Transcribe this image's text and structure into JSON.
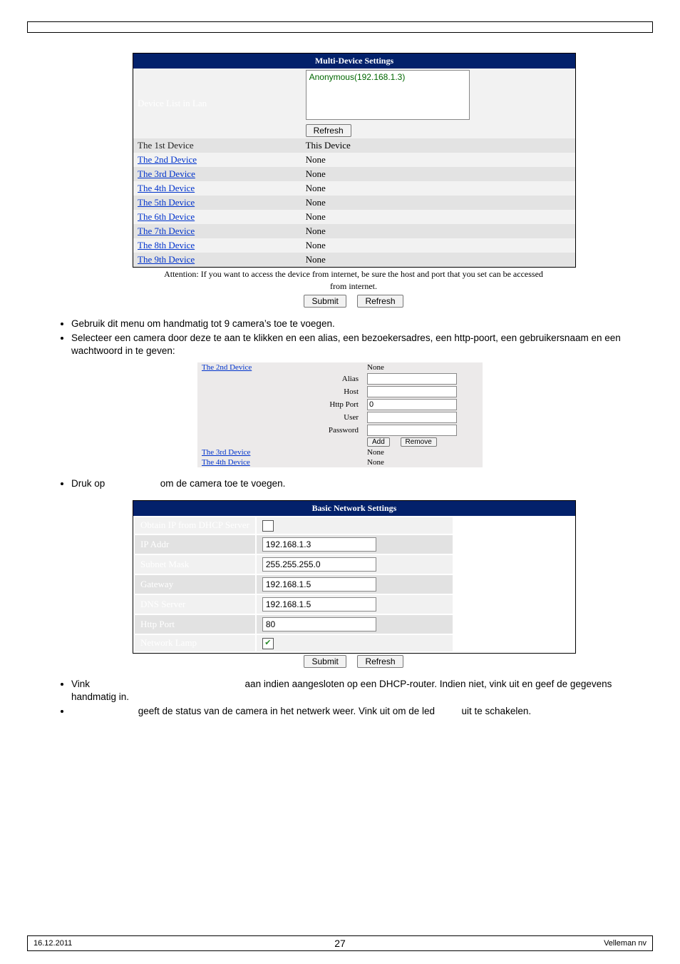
{
  "multi_device": {
    "header": "Multi-Device Settings",
    "row_labels": {
      "device_list": "Device List in Lan"
    },
    "listbox_entry": "Anonymous(192.168.1.3)",
    "refresh_btn": "Refresh",
    "devices": [
      {
        "label": "The 1st Device",
        "value": "This Device",
        "link": false
      },
      {
        "label": "The 2nd Device",
        "value": "None",
        "link": true
      },
      {
        "label": "The 3rd Device",
        "value": "None",
        "link": true
      },
      {
        "label": "The 4th Device",
        "value": "None",
        "link": true
      },
      {
        "label": "The 5th Device",
        "value": "None",
        "link": true
      },
      {
        "label": "The 6th Device",
        "value": "None",
        "link": true
      },
      {
        "label": "The 7th Device",
        "value": "None",
        "link": true
      },
      {
        "label": "The 8th Device",
        "value": "None",
        "link": true
      },
      {
        "label": "The 9th Device",
        "value": "None",
        "link": true
      }
    ],
    "attention_line1": "Attention: If you want to access the device from internet, be sure the host and port that you set can be accessed",
    "attention_line2": "from internet.",
    "submit_btn": "Submit",
    "refresh2_btn": "Refresh"
  },
  "bullets_1": {
    "b1": "Gebruik dit menu om handmatig tot 9 camera’s toe te voegen.",
    "b2": "Selecteer een camera door deze te aan te klikken en een alias, een bezoekersadres, een http-poort, een gebruikersnaam en een wachtwoord in te geven:"
  },
  "device_form": {
    "top_link": "The 2nd Device",
    "top_value": "None",
    "alias": "Alias",
    "host": "Host",
    "http_port": "Http Port",
    "http_port_value": "0",
    "user": "User",
    "password": "Password",
    "add_btn": "Add",
    "remove_btn": "Remove",
    "third": "The 3rd Device",
    "third_v": "None",
    "fourth": "The 4th Device",
    "fourth_v": "None"
  },
  "bullets_2": {
    "druk_prefix": "Druk op ",
    "druk_suffix": " om de camera toe te voegen."
  },
  "network": {
    "header": "Basic Network Settings",
    "rows": {
      "dhcp": "Obtain IP from DHCP Server",
      "ip": "IP Addr",
      "ip_v": "192.168.1.3",
      "subnet": "Subnet Mask",
      "subnet_v": "255.255.255.0",
      "gateway": "Gateway",
      "gateway_v": "192.168.1.5",
      "dns": "DNS Server",
      "dns_v": "192.168.1.5",
      "http": "Http Port",
      "http_v": "80",
      "lamp": "Network Lamp"
    },
    "submit_btn": "Submit",
    "refresh_btn": "Refresh"
  },
  "bullets_3": {
    "vink_prefix": "Vink ",
    "vink_suffix": " aan indien aangesloten op een DHCP-router. Indien niet, vink uit en geef de gegevens handmatig in.",
    "lamp_mid": " geeft de status van de camera in het netwerk weer. Vink uit om de led ",
    "lamp_suffix": " uit te schakelen."
  },
  "footer": {
    "date": "16.12.2011",
    "page": "27",
    "brand": "Velleman nv"
  }
}
